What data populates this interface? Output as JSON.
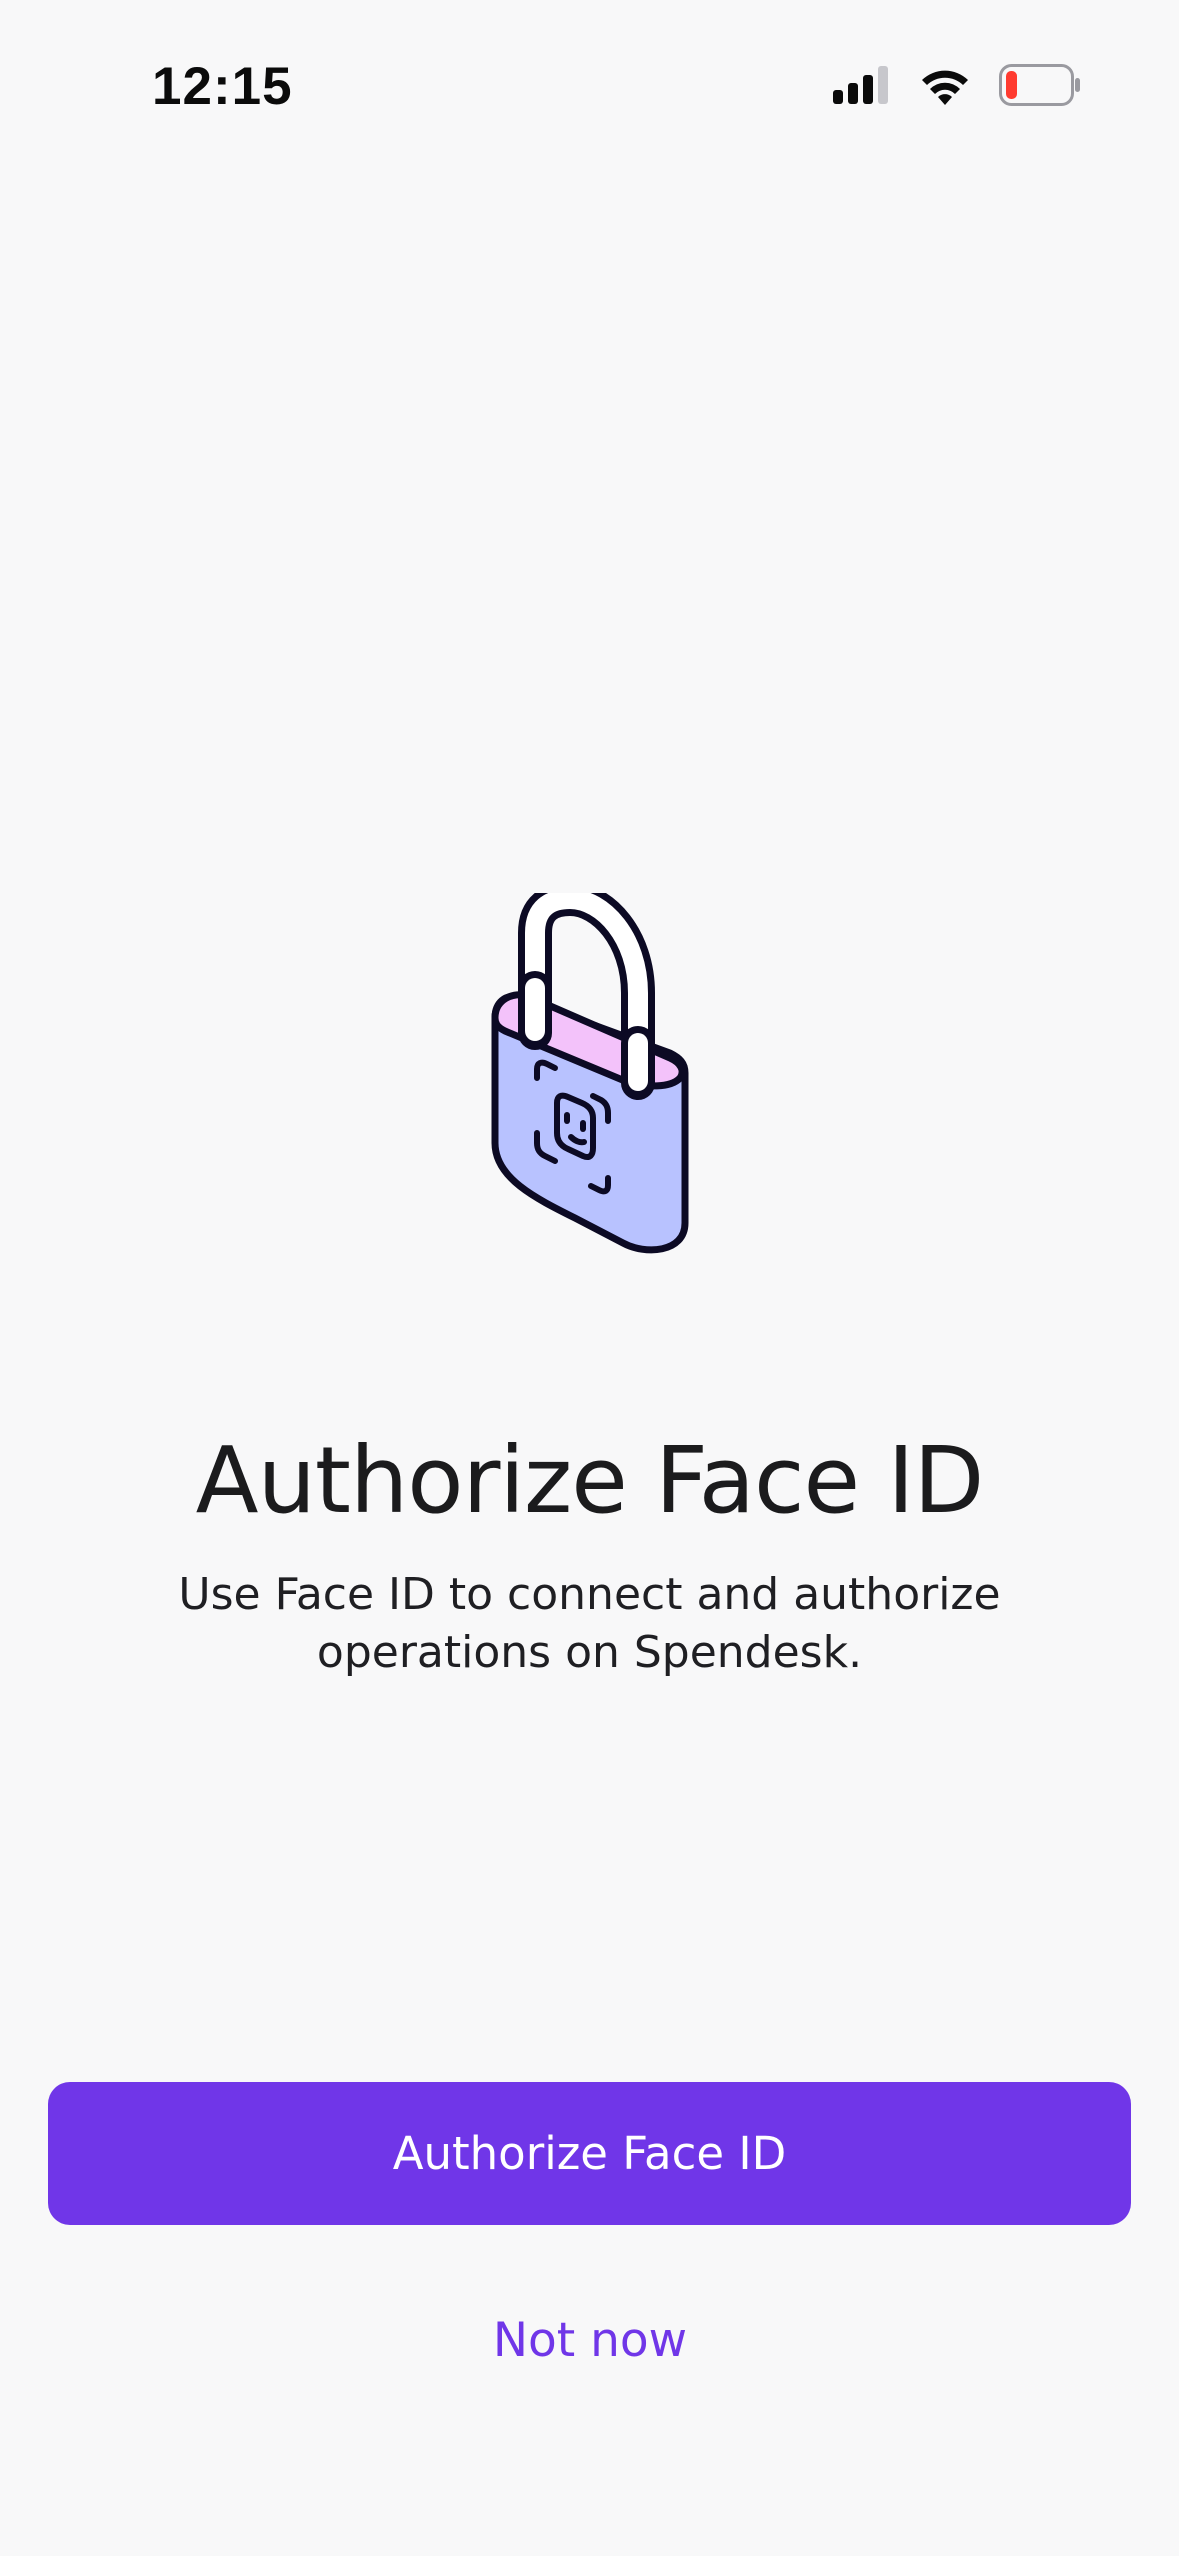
{
  "status_bar": {
    "time": "12:15",
    "icons": [
      "cellular-signal-icon",
      "wifi-icon",
      "battery-low-icon"
    ],
    "battery_color": "#ff3b30"
  },
  "illustration": {
    "icon": "face-id-padlock-icon",
    "colors": {
      "body": "#b8c2ff",
      "top": "#f3c2fa",
      "outline": "#0c0a24"
    }
  },
  "main": {
    "title": "Authorize Face ID",
    "subtitle": "Use Face ID to connect and authorize operations on Spendesk."
  },
  "actions": {
    "primary_label": "Authorize Face ID",
    "secondary_label": "Not now",
    "accent_color": "#7036e8"
  }
}
